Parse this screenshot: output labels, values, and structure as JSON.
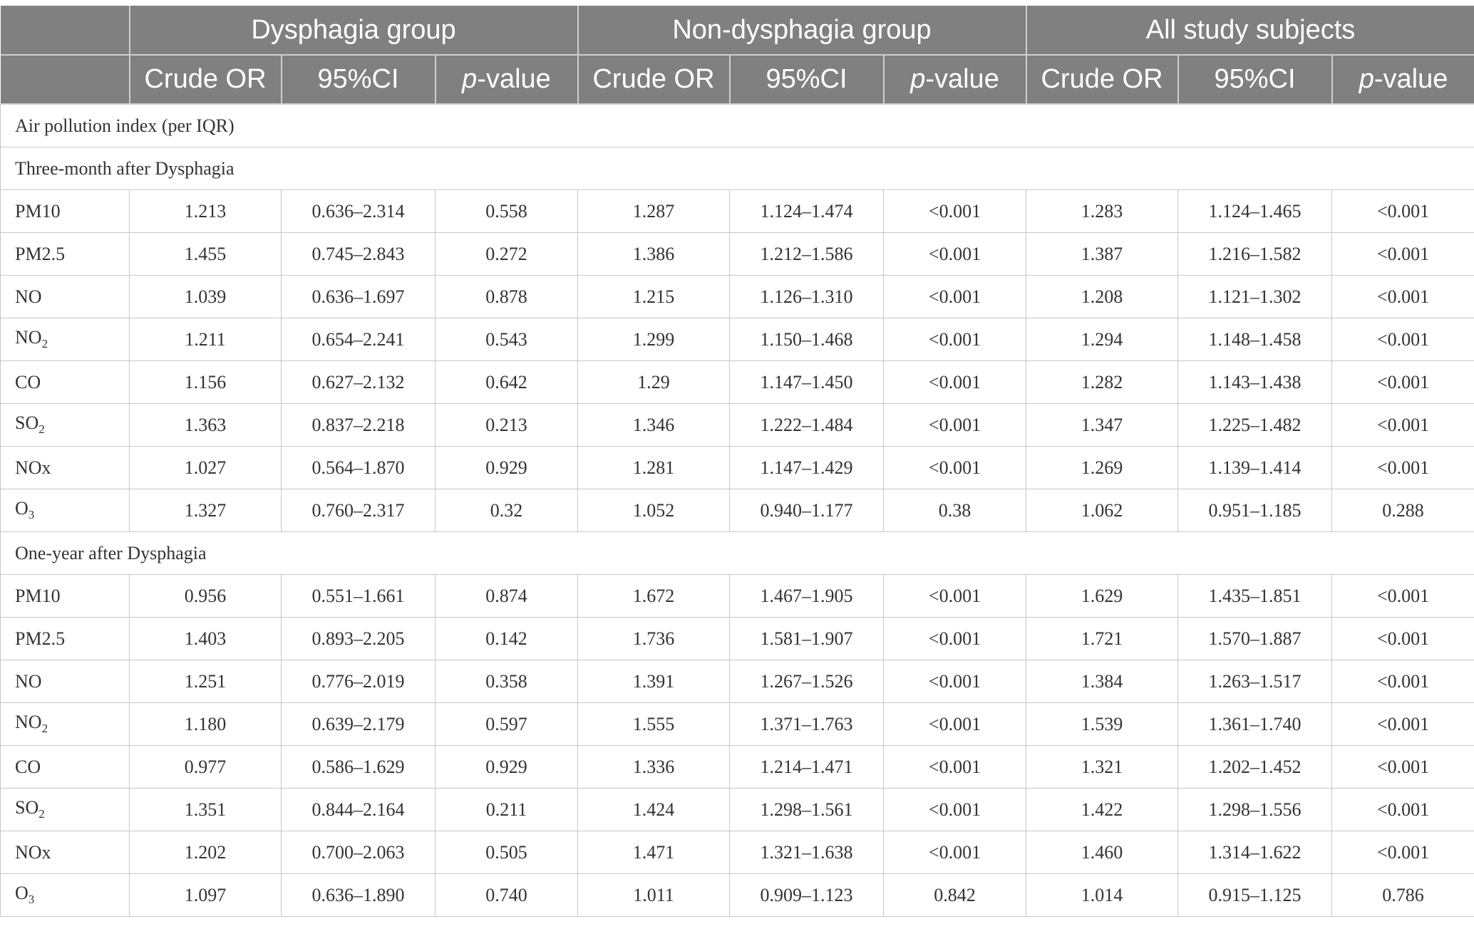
{
  "header": {
    "groups": [
      "Dysphagia group",
      "Non-dysphagia group",
      "All study subjects"
    ],
    "columns": {
      "crude_or": "Crude OR",
      "ci": "95%CI",
      "p_italic": "p",
      "p_rest": "-value"
    }
  },
  "sections": [
    {
      "title": "Air pollution index (per IQR)"
    },
    {
      "title": "Three-month after Dysphagia",
      "rows": [
        {
          "base": "PM10",
          "sub": "",
          "cells": [
            "1.213",
            "0.636–2.314",
            "0.558",
            "1.287",
            "1.124–1.474",
            "<0.001",
            "1.283",
            "1.124–1.465",
            "<0.001"
          ]
        },
        {
          "base": "PM2.5",
          "sub": "",
          "cells": [
            "1.455",
            "0.745–2.843",
            "0.272",
            "1.386",
            "1.212–1.586",
            "<0.001",
            "1.387",
            "1.216–1.582",
            "<0.001"
          ]
        },
        {
          "base": "NO",
          "sub": "",
          "cells": [
            "1.039",
            "0.636–1.697",
            "0.878",
            "1.215",
            "1.126–1.310",
            "<0.001",
            "1.208",
            "1.121–1.302",
            "<0.001"
          ]
        },
        {
          "base": "NO",
          "sub": "2",
          "cells": [
            "1.211",
            "0.654–2.241",
            "0.543",
            "1.299",
            "1.150–1.468",
            "<0.001",
            "1.294",
            "1.148–1.458",
            "<0.001"
          ]
        },
        {
          "base": "CO",
          "sub": "",
          "cells": [
            "1.156",
            "0.627–2.132",
            "0.642",
            "1.29",
            "1.147–1.450",
            "<0.001",
            "1.282",
            "1.143–1.438",
            "<0.001"
          ]
        },
        {
          "base": "SO",
          "sub": "2",
          "cells": [
            "1.363",
            "0.837–2.218",
            "0.213",
            "1.346",
            "1.222–1.484",
            "<0.001",
            "1.347",
            "1.225–1.482",
            "<0.001"
          ]
        },
        {
          "base": "NOx",
          "sub": "",
          "cells": [
            "1.027",
            "0.564–1.870",
            "0.929",
            "1.281",
            "1.147–1.429",
            "<0.001",
            "1.269",
            "1.139–1.414",
            "<0.001"
          ]
        },
        {
          "base": "O",
          "sub": "3",
          "cells": [
            "1.327",
            "0.760–2.317",
            "0.32",
            "1.052",
            "0.940–1.177",
            "0.38",
            "1.062",
            "0.951–1.185",
            "0.288"
          ]
        }
      ]
    },
    {
      "title": "One-year after Dysphagia",
      "rows": [
        {
          "base": "PM10",
          "sub": "",
          "cells": [
            "0.956",
            "0.551–1.661",
            "0.874",
            "1.672",
            "1.467–1.905",
            "<0.001",
            "1.629",
            "1.435–1.851",
            "<0.001"
          ]
        },
        {
          "base": "PM2.5",
          "sub": "",
          "cells": [
            "1.403",
            "0.893–2.205",
            "0.142",
            "1.736",
            "1.581–1.907",
            "<0.001",
            "1.721",
            "1.570–1.887",
            "<0.001"
          ]
        },
        {
          "base": "NO",
          "sub": "",
          "cells": [
            "1.251",
            "0.776–2.019",
            "0.358",
            "1.391",
            "1.267–1.526",
            "<0.001",
            "1.384",
            "1.263–1.517",
            "<0.001"
          ]
        },
        {
          "base": "NO",
          "sub": "2",
          "cells": [
            "1.180",
            "0.639–2.179",
            "0.597",
            "1.555",
            "1.371–1.763",
            "<0.001",
            "1.539",
            "1.361–1.740",
            "<0.001"
          ]
        },
        {
          "base": "CO",
          "sub": "",
          "cells": [
            "0.977",
            "0.586–1.629",
            "0.929",
            "1.336",
            "1.214–1.471",
            "<0.001",
            "1.321",
            "1.202–1.452",
            "<0.001"
          ]
        },
        {
          "base": "SO",
          "sub": "2",
          "cells": [
            "1.351",
            "0.844–2.164",
            "0.211",
            "1.424",
            "1.298–1.561",
            "<0.001",
            "1.422",
            "1.298–1.556",
            "<0.001"
          ]
        },
        {
          "base": "NOx",
          "sub": "",
          "cells": [
            "1.202",
            "0.700–2.063",
            "0.505",
            "1.471",
            "1.321–1.638",
            "<0.001",
            "1.460",
            "1.314–1.622",
            "<0.001"
          ]
        },
        {
          "base": "O",
          "sub": "3",
          "cells": [
            "1.097",
            "0.636–1.890",
            "0.740",
            "1.011",
            "0.909–1.123",
            "0.842",
            "1.014",
            "0.915–1.125",
            "0.786"
          ]
        }
      ]
    }
  ]
}
